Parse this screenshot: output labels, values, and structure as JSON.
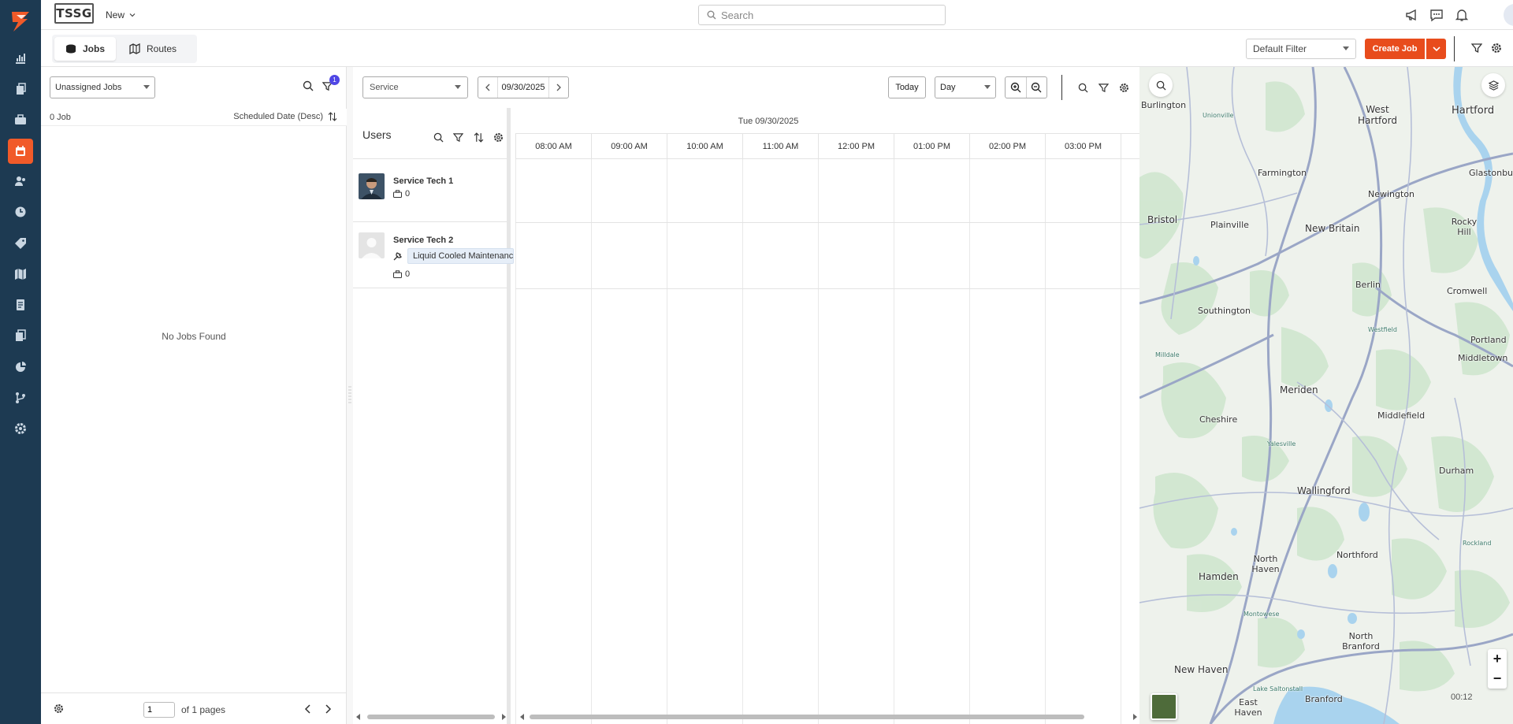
{
  "colors": {
    "nav_bg": "#1d3a52",
    "accent": "#f15a29",
    "create_job": "#e84c1c",
    "filter_badge": "#4f46e5"
  },
  "header": {
    "brand": "TSSG",
    "new_label": "New",
    "search_placeholder": "Search"
  },
  "left_nav": {
    "items": [
      "dashboard-icon",
      "documents-icon",
      "briefcase-icon",
      "calendar-icon",
      "users-icon",
      "clock-icon",
      "tag-icon",
      "map-icon",
      "invoice-icon",
      "files-icon",
      "reports-icon",
      "workflow-icon",
      "settings-icon"
    ],
    "active_index": 3
  },
  "tabs": [
    {
      "label": "Jobs",
      "active": true
    },
    {
      "label": "Routes",
      "active": false
    }
  ],
  "toolbar": {
    "filter_select": "Default Filter",
    "create_job_label": "Create Job"
  },
  "jobs_panel": {
    "select_value": "Unassigned Jobs",
    "filter_badge": "1",
    "count_text": "0 Job",
    "sort_text": "Scheduled Date (Desc)",
    "empty_text": "No Jobs Found",
    "page_value": "1",
    "page_total_text": "of 1 pages"
  },
  "scheduler": {
    "service_select": "Service",
    "date_value": "09/30/2025",
    "today_label": "Today",
    "view_select": "Day",
    "users_title": "Users",
    "timeline_date": "Tue 09/30/2025",
    "hours": [
      "08:00 AM",
      "09:00 AM",
      "10:00 AM",
      "11:00 AM",
      "12:00 PM",
      "01:00 PM",
      "02:00 PM",
      "03:00 PM"
    ],
    "users": [
      {
        "name": "Service Tech 1",
        "job_count": "0",
        "skill": ""
      },
      {
        "name": "Service Tech 2",
        "job_count": "0",
        "skill": "Liquid Cooled Maintenance"
      }
    ]
  },
  "map": {
    "labels": [
      "Burlington",
      "Unionville",
      "West Hartford",
      "Hartford",
      "Farmington",
      "Glastonbury",
      "Newington",
      "Bristol",
      "Plainville",
      "New Britain",
      "Rocky Hill",
      "Berlin",
      "Cromwell",
      "Southington",
      "Portland",
      "Middletown",
      "Meriden",
      "Cheshire",
      "Middlefield",
      "Wallingford",
      "Durham",
      "Hamden",
      "North Haven",
      "Northford",
      "New Haven",
      "North Branford",
      "East Haven",
      "Branford",
      "Milldale",
      "Yalesville",
      "Westfield",
      "Rockland",
      "Lake Saltonstall",
      "Montowese"
    ],
    "zoom_in": "+",
    "zoom_out": "−",
    "timer": "00:12"
  }
}
